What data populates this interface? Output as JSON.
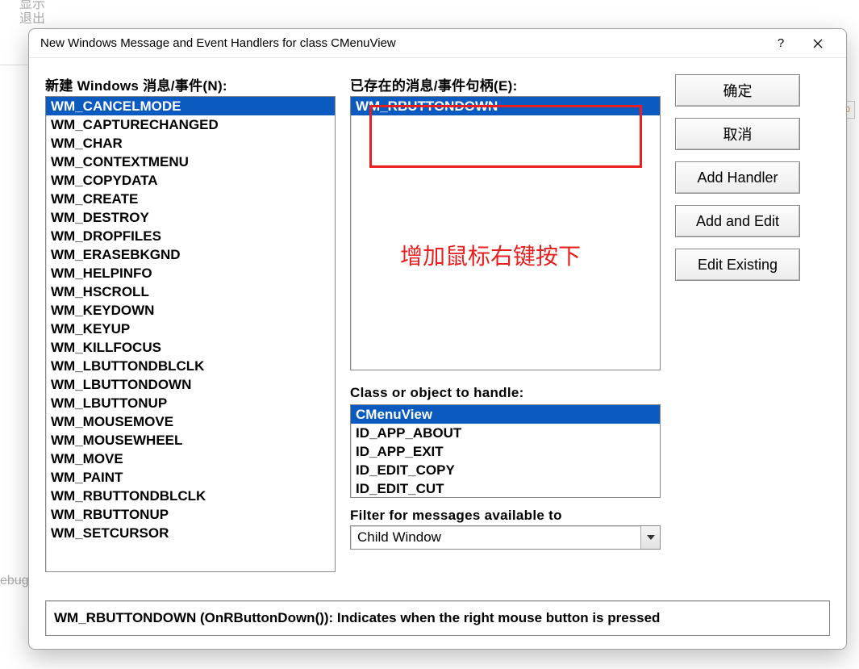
{
  "bg": {
    "line1": "显示",
    "line2": "退出",
    "debug": "ebug"
  },
  "dialog": {
    "title": "New Windows Message and Event Handlers for class CMenuView",
    "help_label": "?",
    "close_label": "✕"
  },
  "labels": {
    "new_messages": "新建 Windows 消息/事件(N):",
    "existing_handlers": "已存在的消息/事件句柄(E):",
    "class_or_object": "Class or object to handle:",
    "filter": "Filter for messages available to"
  },
  "buttons": {
    "ok": "确定",
    "cancel": "取消",
    "add_handler": "Add Handler",
    "add_and_edit": "Add and Edit",
    "edit_existing": "Edit Existing"
  },
  "new_messages": [
    "WM_CANCELMODE",
    "WM_CAPTURECHANGED",
    "WM_CHAR",
    "WM_CONTEXTMENU",
    "WM_COPYDATA",
    "WM_CREATE",
    "WM_DESTROY",
    "WM_DROPFILES",
    "WM_ERASEBKGND",
    "WM_HELPINFO",
    "WM_HSCROLL",
    "WM_KEYDOWN",
    "WM_KEYUP",
    "WM_KILLFOCUS",
    "WM_LBUTTONDBLCLK",
    "WM_LBUTTONDOWN",
    "WM_LBUTTONUP",
    "WM_MOUSEMOVE",
    "WM_MOUSEWHEEL",
    "WM_MOVE",
    "WM_PAINT",
    "WM_RBUTTONDBLCLK",
    "WM_RBUTTONUP",
    "WM_SETCURSOR"
  ],
  "new_messages_selected": 0,
  "existing_handlers": [
    "WM_RBUTTONDOWN"
  ],
  "existing_selected": 0,
  "class_items": [
    "CMenuView",
    "ID_APP_ABOUT",
    "ID_APP_EXIT",
    "ID_EDIT_COPY",
    "ID_EDIT_CUT"
  ],
  "class_selected": 0,
  "filter_value": "Child Window",
  "description": "WM_RBUTTONDOWN (OnRButtonDown()):  Indicates when the right mouse button is pressed",
  "annotation": {
    "text": "增加鼠标右键按下"
  }
}
